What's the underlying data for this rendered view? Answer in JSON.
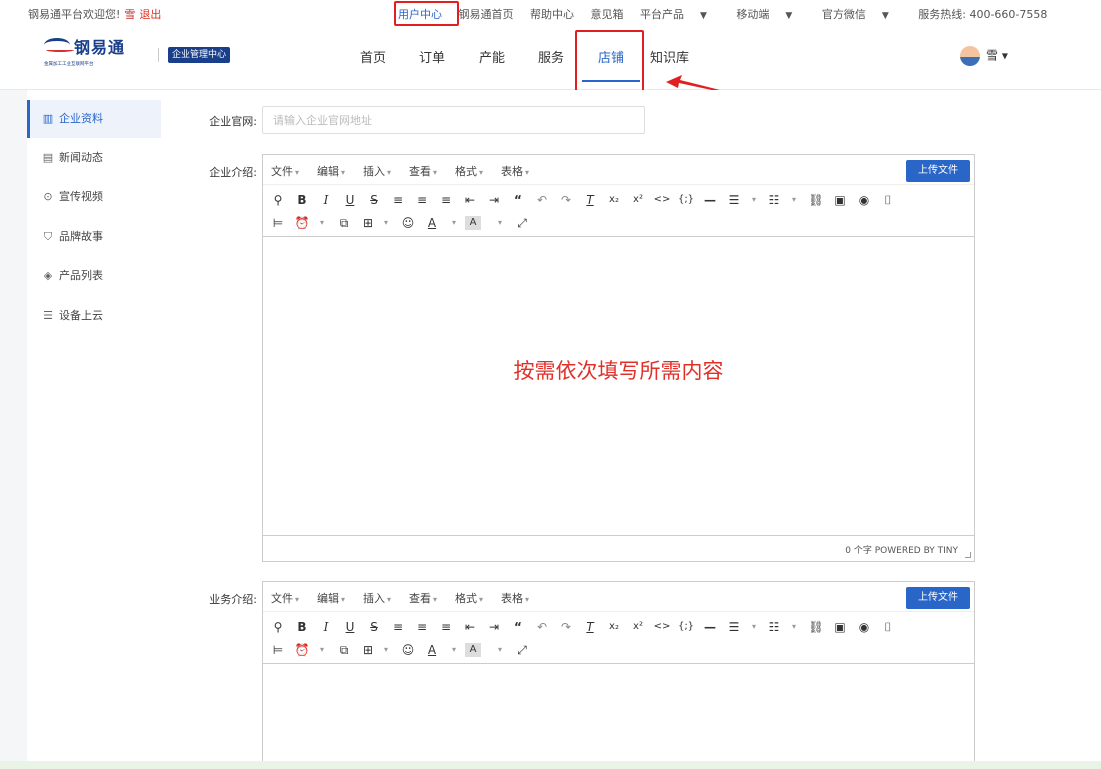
{
  "topbar": {
    "welcome": "钢易通平台欢迎您!",
    "username": "雪",
    "logout": "退出",
    "links": {
      "user_center": "用户中心",
      "home": "钢易通首页",
      "help": "帮助中心",
      "feedback": "意见箱",
      "platform_products": "平台产品",
      "mobile": "移动端",
      "wechat": "官方微信",
      "hotline": "服务热线: 400-660-7558"
    },
    "caret": "▼"
  },
  "header": {
    "logo_name": "钢易通",
    "logo_sub": "金属加工工业互联网平台",
    "badge": "企业管理中心",
    "nav": [
      "首页",
      "订单",
      "产能",
      "服务",
      "店铺",
      "知识库"
    ],
    "active_nav": "店铺",
    "user": "雪 ▾"
  },
  "sidebar": {
    "items": [
      {
        "label": "企业资料",
        "icon": "building-icon",
        "glyph": "▥"
      },
      {
        "label": "新闻动态",
        "icon": "news-icon",
        "glyph": "▤"
      },
      {
        "label": "宣传视频",
        "icon": "play-circle-icon",
        "glyph": "⊙"
      },
      {
        "label": "品牌故事",
        "icon": "brand-icon",
        "glyph": "⛉"
      },
      {
        "label": "产品列表",
        "icon": "box-icon",
        "glyph": "◈"
      },
      {
        "label": "设备上云",
        "icon": "server-icon",
        "glyph": "☰"
      }
    ],
    "active": "企业资料"
  },
  "form": {
    "website_label": "企业官网:",
    "website_placeholder": "请输入企业官网地址",
    "website_value": "",
    "intro_label": "企业介绍:",
    "business_label": "业务介绍:"
  },
  "editor": {
    "menus": [
      "文件",
      "编辑",
      "插入",
      "查看",
      "格式",
      "表格"
    ],
    "menu_caret": "▾",
    "upload_label": "上传文件",
    "hint": "按需依次填写所需内容",
    "status": "0 个字 POWERED BY TINY"
  },
  "colors": {
    "accent": "#2a66c8",
    "highlight": "#e02020",
    "brand": "#1a3f8a"
  }
}
